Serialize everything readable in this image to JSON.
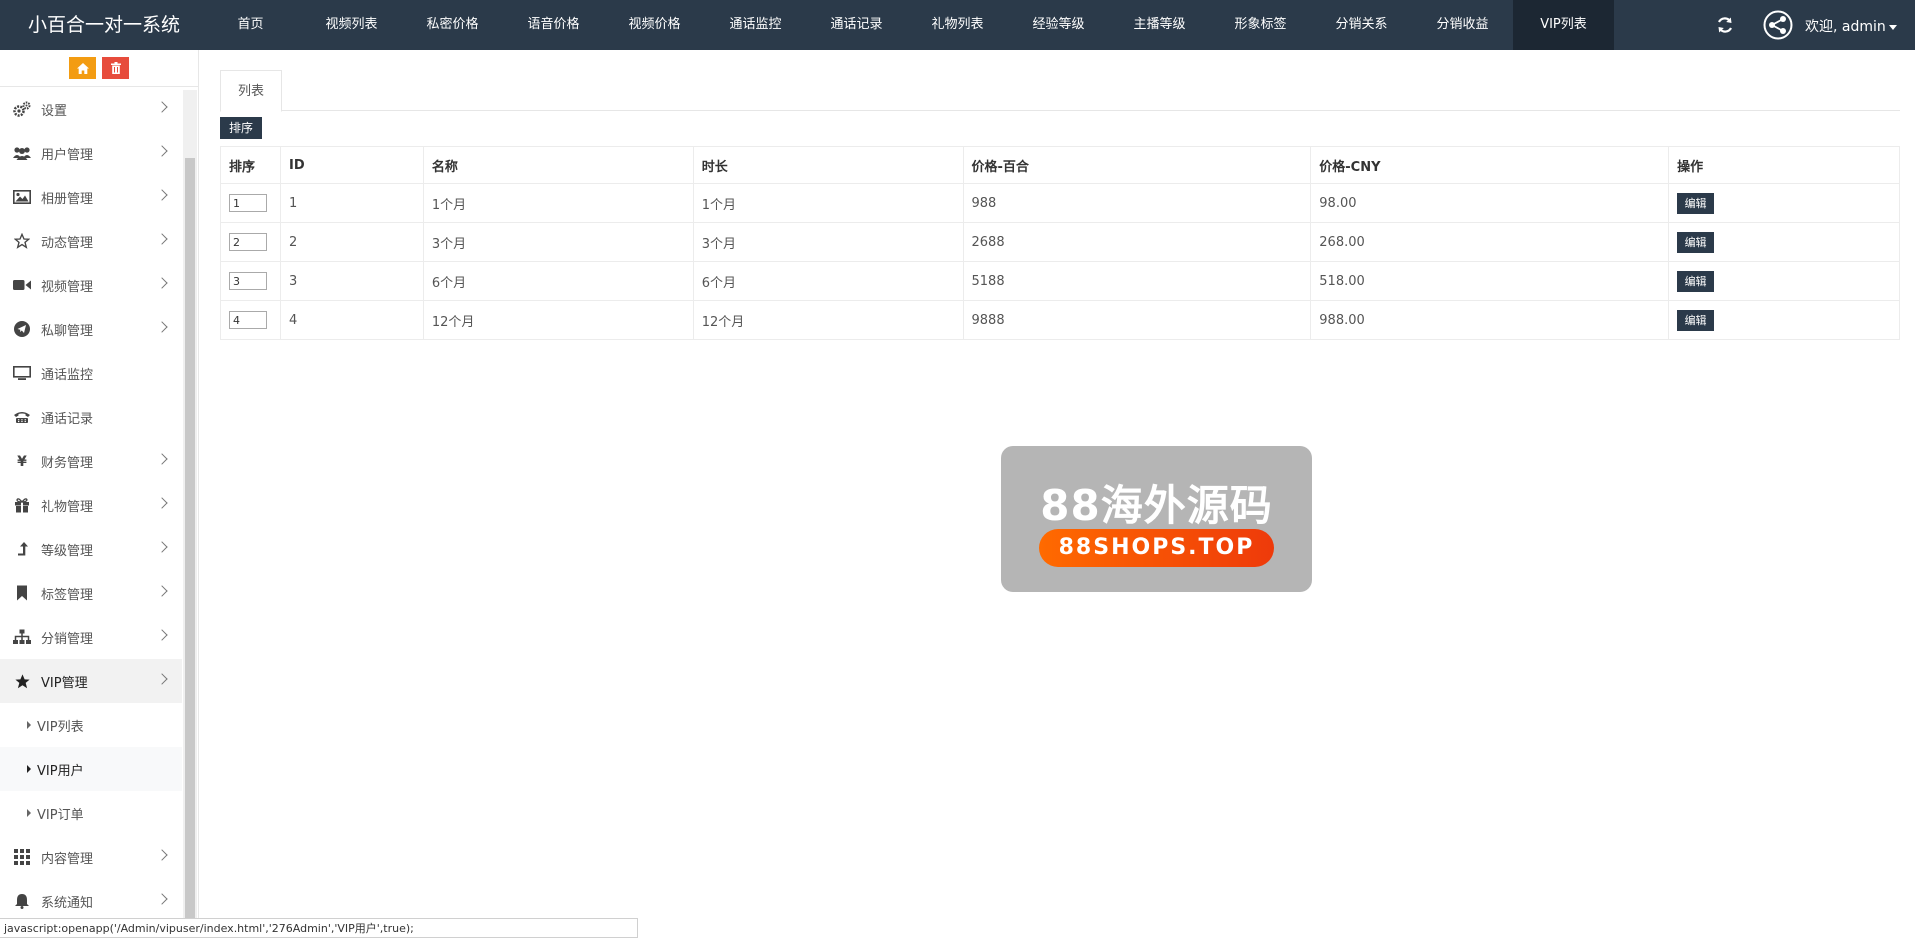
{
  "app": {
    "title": "小百合一对一系统",
    "user_greeting": "欢迎, admin"
  },
  "topnav": [
    {
      "label": "首页"
    },
    {
      "label": "视频列表"
    },
    {
      "label": "私密价格"
    },
    {
      "label": "语音价格"
    },
    {
      "label": "视频价格"
    },
    {
      "label": "通话监控"
    },
    {
      "label": "通话记录"
    },
    {
      "label": "礼物列表"
    },
    {
      "label": "经验等级"
    },
    {
      "label": "主播等级"
    },
    {
      "label": "形象标签"
    },
    {
      "label": "分销关系"
    },
    {
      "label": "分销收益"
    },
    {
      "label": "VIP列表",
      "active": true
    }
  ],
  "sidebar": {
    "items": [
      {
        "label": "设置",
        "icon": "gears-icon",
        "expandable": true
      },
      {
        "label": "用户管理",
        "icon": "users-icon",
        "expandable": true
      },
      {
        "label": "相册管理",
        "icon": "image-icon",
        "expandable": true
      },
      {
        "label": "动态管理",
        "icon": "star-outline-icon",
        "expandable": true
      },
      {
        "label": "视频管理",
        "icon": "video-camera-icon",
        "expandable": true
      },
      {
        "label": "私聊管理",
        "icon": "paper-plane-icon",
        "expandable": true
      },
      {
        "label": "通话监控",
        "icon": "monitor-icon",
        "expandable": false
      },
      {
        "label": "通话记录",
        "icon": "phone-icon",
        "expandable": false
      },
      {
        "label": "财务管理",
        "icon": "yen-icon",
        "expandable": true
      },
      {
        "label": "礼物管理",
        "icon": "gift-icon",
        "expandable": true
      },
      {
        "label": "等级管理",
        "icon": "level-up-icon",
        "expandable": true
      },
      {
        "label": "标签管理",
        "icon": "bookmark-icon",
        "expandable": true
      },
      {
        "label": "分销管理",
        "icon": "sitemap-icon",
        "expandable": true
      },
      {
        "label": "VIP管理",
        "icon": "star-icon",
        "expandable": true,
        "open": true
      },
      {
        "label": "内容管理",
        "icon": "grid-icon",
        "expandable": true
      },
      {
        "label": "系统通知",
        "icon": "bell-icon",
        "expandable": true
      }
    ],
    "vip_subitems": [
      {
        "label": "VIP列表"
      },
      {
        "label": "VIP用户",
        "active": true
      },
      {
        "label": "VIP订单"
      }
    ]
  },
  "main": {
    "tab_label": "列表",
    "sort_button": "排序",
    "edit_label": "编辑",
    "columns": [
      "排序",
      "ID",
      "名称",
      "时长",
      "价格-百合",
      "价格-CNY",
      "操作"
    ],
    "rows": [
      {
        "order": "1",
        "id": "1",
        "name": "1个月",
        "duration": "1个月",
        "price_lily": "988",
        "price_cny": "98.00"
      },
      {
        "order": "2",
        "id": "2",
        "name": "3个月",
        "duration": "3个月",
        "price_lily": "2688",
        "price_cny": "268.00"
      },
      {
        "order": "3",
        "id": "3",
        "name": "6个月",
        "duration": "6个月",
        "price_lily": "5188",
        "price_cny": "518.00"
      },
      {
        "order": "4",
        "id": "4",
        "name": "12个月",
        "duration": "12个月",
        "price_lily": "9888",
        "price_cny": "988.00"
      }
    ]
  },
  "watermark": {
    "title": "88海外源码",
    "url": "88SHOPS.TOP"
  },
  "statusbar": {
    "text": "javascript:openapp('/Admin/vipuser/index.html','276Admin','VIP用户',true);"
  },
  "colors": {
    "navbar": "#2b3a4a",
    "navbar_active": "#1c2733",
    "home_button": "#f39c12",
    "trash_button": "#e74c3c",
    "watermark_pill": "#ff6a00"
  }
}
